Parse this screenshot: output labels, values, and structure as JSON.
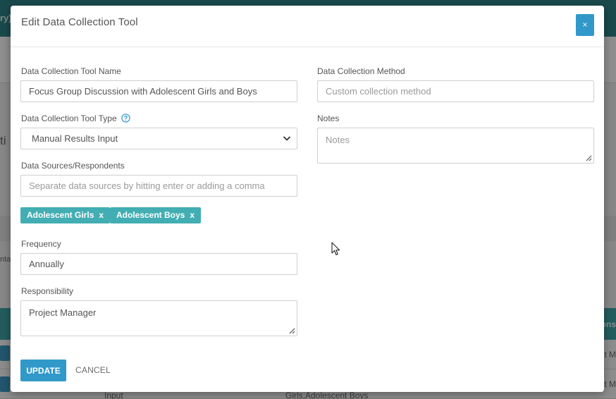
{
  "background": {
    "topbar_fragment": "ry)",
    "left_fragment_1": "ti",
    "left_fragment_2": "nta",
    "header_fragment": "ons",
    "rows": [
      {
        "right_cell": "ct M"
      },
      {
        "col_a": "Input",
        "col_b": "Girls,Adolescent Boys",
        "right_cell": "ct M"
      }
    ]
  },
  "modal": {
    "title": "Edit Data Collection Tool",
    "close_label": "×",
    "fields": {
      "tool_name": {
        "label": "Data Collection Tool Name",
        "value": "Focus Group Discussion with Adolescent Girls and Boys"
      },
      "tool_type": {
        "label": "Data Collection Tool Type",
        "value": "Manual Results Input"
      },
      "data_sources": {
        "label": "Data Sources/Respondents",
        "placeholder": "Separate data sources by hitting enter or adding a comma",
        "tags": [
          {
            "label": "Adolescent Girls",
            "remove": "x"
          },
          {
            "label": "Adolescent Boys",
            "remove": "x"
          }
        ]
      },
      "frequency": {
        "label": "Frequency",
        "value": "Annually"
      },
      "responsibility": {
        "label": "Responsibility",
        "value": "Project Manager"
      },
      "method": {
        "label": "Data Collection Method",
        "placeholder": "Custom collection method"
      },
      "notes": {
        "label": "Notes",
        "placeholder": "Notes"
      }
    },
    "buttons": {
      "update": "UPDATE",
      "cancel": "CANCEL"
    }
  },
  "colors": {
    "primary": "#3199c9",
    "tag": "#42aeb3",
    "topbar": "#2e7f83",
    "table_header": "#3f9fa3"
  },
  "icons": {
    "help": "question-circle-icon",
    "dropdown": "chevron-down-icon",
    "pointer": "mouse-pointer-icon"
  }
}
